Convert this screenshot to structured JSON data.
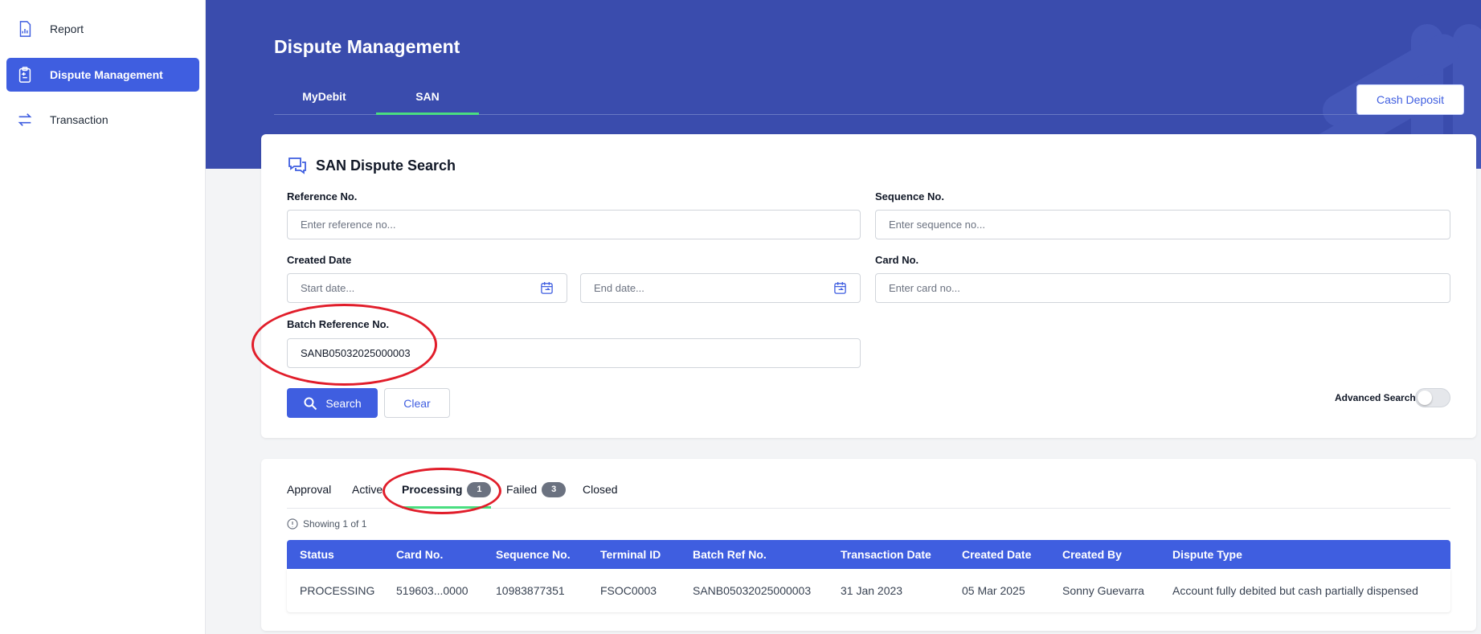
{
  "sidebar": {
    "items": [
      {
        "label": "Report",
        "icon": "report-icon"
      },
      {
        "label": "Dispute Management",
        "icon": "clipboard-icon"
      },
      {
        "label": "Transaction",
        "icon": "transfer-arrows-icon"
      }
    ]
  },
  "header": {
    "title": "Dispute Management",
    "tabs": [
      {
        "label": "MyDebit"
      },
      {
        "label": "SAN"
      }
    ],
    "cash_deposit_label": "Cash Deposit"
  },
  "search": {
    "title": "SAN Dispute Search",
    "reference_label": "Reference No.",
    "reference_placeholder": "Enter reference no...",
    "sequence_label": "Sequence No.",
    "sequence_placeholder": "Enter sequence no...",
    "created_date_label": "Created Date",
    "start_placeholder": "Start date...",
    "end_placeholder": "End date...",
    "card_label": "Card No.",
    "card_placeholder": "Enter card no...",
    "batch_label": "Batch Reference No.",
    "batch_value": "SANB05032025000003",
    "search_button": "Search",
    "clear_button": "Clear",
    "advanced_label": "Advanced Search",
    "advanced_on": false
  },
  "results": {
    "tabs": [
      {
        "label": "Approval",
        "badge": null
      },
      {
        "label": "Active",
        "badge": null
      },
      {
        "label": "Processing",
        "badge": "1"
      },
      {
        "label": "Failed",
        "badge": "3"
      },
      {
        "label": "Closed",
        "badge": null
      }
    ],
    "active_tab": "Processing",
    "showing": "Showing 1 of 1",
    "columns": [
      "Status",
      "Card No.",
      "Sequence No.",
      "Terminal ID",
      "Batch Ref No.",
      "Transaction Date",
      "Created Date",
      "Created By",
      "Dispute Type"
    ],
    "rows": [
      [
        "PROCESSING",
        "519603...0000",
        "10983877351",
        "FSOC0003",
        "SANB05032025000003",
        "31 Jan 2023",
        "05 Mar 2025",
        "Sonny Guevarra",
        "Account fully debited but cash partially dispensed"
      ]
    ]
  },
  "colors": {
    "header_bg": "#3a4cad",
    "accent": "#3f5ee0",
    "active_tab_underline": "#4ade80",
    "annotation": "#e11d2a"
  }
}
